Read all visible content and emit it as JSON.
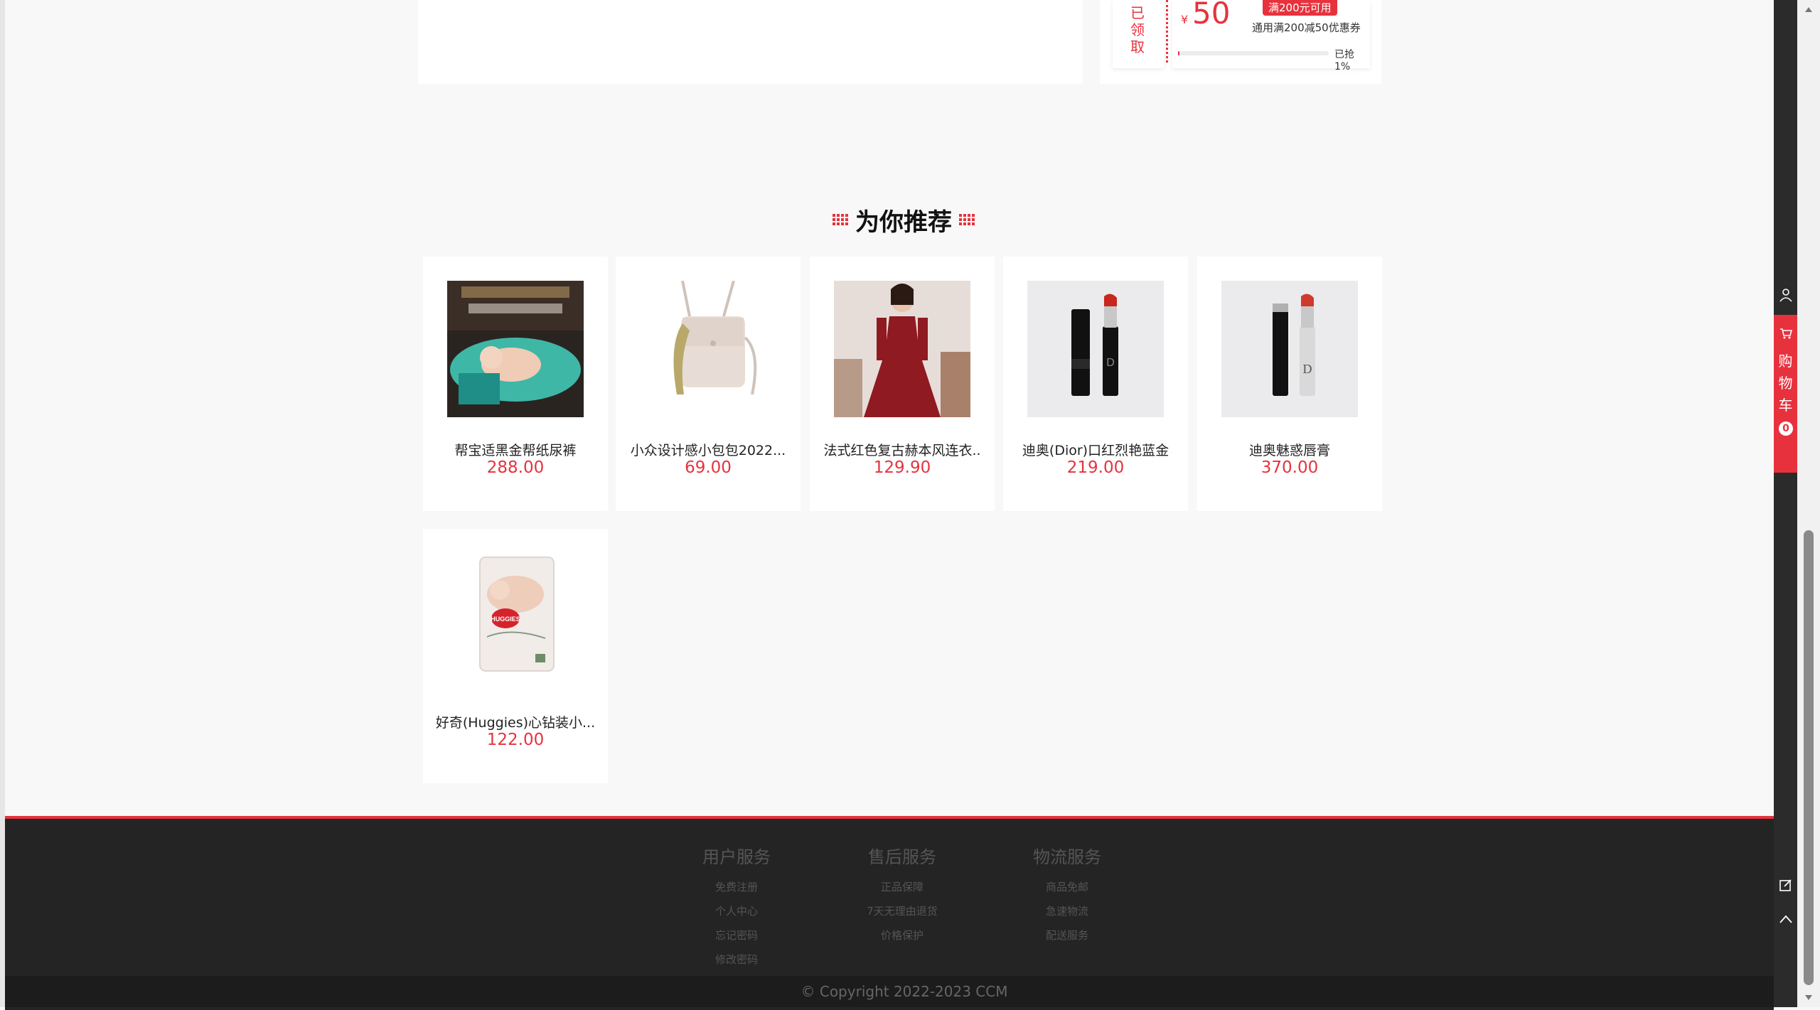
{
  "coupon": {
    "status": "已领取",
    "currency": "¥",
    "amount": "50",
    "condition": "满200元可用",
    "description": "通用满200减50优惠券",
    "claimed_text": "已抢1%",
    "claimed_fraction": 0.01
  },
  "recommend": {
    "title": "为你推荐"
  },
  "products": [
    {
      "name": "帮宝适黑金帮纸尿裤",
      "price": "288.00",
      "image": "pampers-diaper-image"
    },
    {
      "name": "小众设计感小包包2022...",
      "price": "69.00",
      "image": "handbag-image"
    },
    {
      "name": "法式红色复古赫本风连衣..",
      "price": "129.90",
      "image": "red-dress-image"
    },
    {
      "name": "迪奥(Dior)口红烈艳蓝金",
      "price": "219.00",
      "image": "dior-lipstick-image"
    },
    {
      "name": "迪奥魅惑唇膏",
      "price": "370.00",
      "image": "dior-lip-glow-image"
    },
    {
      "name": "好奇(Huggies)心钻装小...",
      "price": "122.00",
      "image": "huggies-diaper-image"
    }
  ],
  "footer": {
    "columns": [
      {
        "title": "用户服务",
        "links": [
          "免费注册",
          "个人中心",
          "忘记密码",
          "修改密码"
        ]
      },
      {
        "title": "售后服务",
        "links": [
          "正品保障",
          "7天无理由退货",
          "价格保护"
        ]
      },
      {
        "title": "物流服务",
        "links": [
          "商品免邮",
          "急速物流",
          "配送服务"
        ]
      }
    ],
    "copyright": "© Copyright 2022-2023 CCM"
  },
  "toolbar": {
    "cart_label": "购物车",
    "cart_count": "0"
  },
  "colors": {
    "accent": "#e7323d",
    "footer_bg": "#242424",
    "toolbar_bg": "#2b2b2b"
  }
}
